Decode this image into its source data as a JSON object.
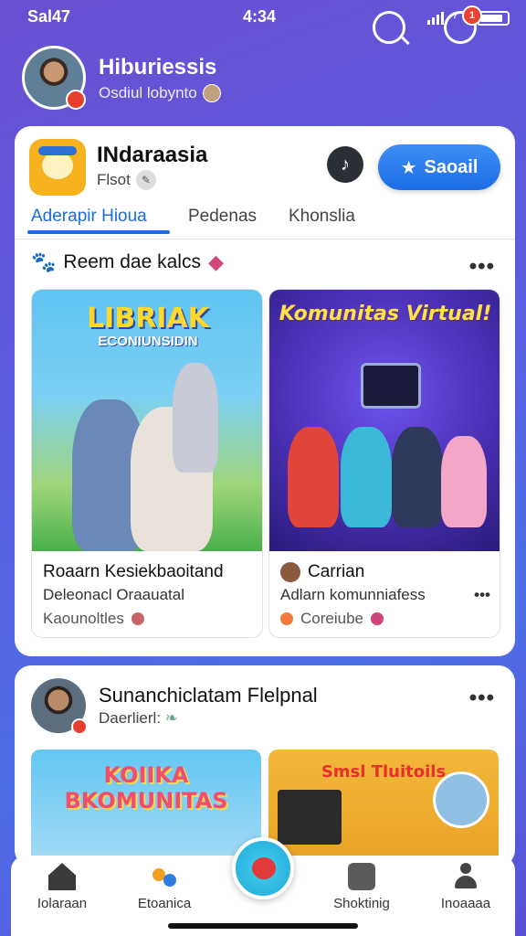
{
  "status_bar": {
    "left": "Sal47",
    "time": "4:34"
  },
  "profile": {
    "name": "Hiburiessis",
    "subtitle": "Osdiul lobynto",
    "notification_count": "1"
  },
  "page": {
    "title": "INdaraasia",
    "subtitle": "Flsot",
    "save_label": "Saoail",
    "tabs": [
      {
        "label": "Aderapir Hioua"
      },
      {
        "label": "Pedenas"
      },
      {
        "label": "Khonslia"
      }
    ],
    "section_title": "Reem dae kalcs",
    "posts": [
      {
        "image_title": "LIBRIAK",
        "image_subtitle": "ECONIUNSIDIN",
        "title": "Roaarn Kesiekbaoitand",
        "desc": "Deleonacl Oraauatal",
        "meta": "Kaounoltles"
      },
      {
        "image_title": "Komunitas Virtual!",
        "title": "Carrian",
        "desc": "Adlarn komunniafess",
        "meta": "Coreiube"
      }
    ]
  },
  "second_post": {
    "title": "Sunanchiclatam Flelpnal",
    "subtitle": "Daerlierl:",
    "thumb_a_title": "KOIIKA BKOMUNITAS",
    "thumb_b_title": "Smsl Tluitoils"
  },
  "bottom_nav": [
    {
      "label": "Iolaraan",
      "icon": "home-icon"
    },
    {
      "label": "Etoanica",
      "icon": "game-icon"
    },
    {
      "label": "Shoktinig",
      "icon": "box-icon"
    },
    {
      "label": "Inoaaaa",
      "icon": "user-icon"
    }
  ],
  "colors": {
    "accent": "#1b6de0",
    "background": "#5a5ce0",
    "badge": "#e63f2e"
  }
}
